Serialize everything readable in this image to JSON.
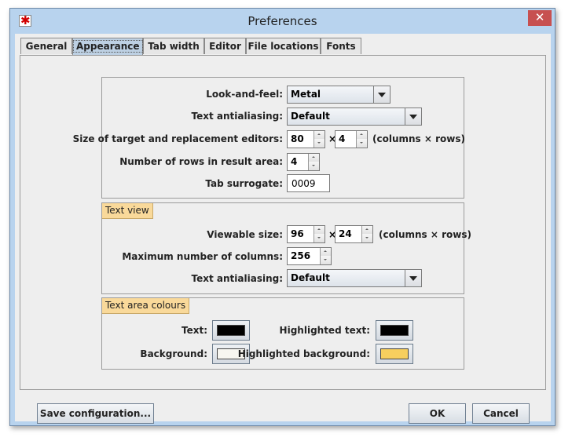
{
  "window": {
    "title": "Preferences",
    "close_glyph": "✕",
    "app_icon_glyph": "✱"
  },
  "tabs": [
    {
      "label": "General",
      "active": false
    },
    {
      "label": "Appearance",
      "active": true
    },
    {
      "label": "Tab width",
      "active": false
    },
    {
      "label": "Editor",
      "active": false
    },
    {
      "label": "File locations",
      "active": false
    },
    {
      "label": "Fonts",
      "active": false
    }
  ],
  "general": {
    "look_and_feel_label": "Look-and-feel:",
    "look_and_feel_value": "Metal",
    "text_antialiasing_label": "Text antialiasing:",
    "text_antialiasing_value": "Default",
    "editor_size_label": "Size of target and replacement editors:",
    "editor_columns": "80",
    "editor_rows": "4",
    "times": "×",
    "columns_rows_unit": "(columns × rows)",
    "result_rows_label": "Number of rows in result area:",
    "result_rows_value": "4",
    "tab_surrogate_label": "Tab surrogate:",
    "tab_surrogate_value": "0009"
  },
  "text_view": {
    "title": "Text view",
    "viewable_size_label": "Viewable size:",
    "viewable_columns": "96",
    "viewable_rows": "24",
    "times": "×",
    "columns_rows_unit": "(columns × rows)",
    "max_columns_label": "Maximum number of columns:",
    "max_columns_value": "256",
    "text_antialiasing_label": "Text antialiasing:",
    "text_antialiasing_value": "Default"
  },
  "text_area_colours": {
    "title": "Text area colours",
    "text_label": "Text:",
    "text_color": "#000000",
    "background_label": "Background:",
    "background_color": "#f7f6f0",
    "highlighted_text_label": "Highlighted text:",
    "highlighted_text_color": "#000000",
    "highlighted_background_label": "Highlighted background:",
    "highlighted_background_color": "#f7cf5e"
  },
  "buttons": {
    "save": "Save configuration...",
    "ok": "OK",
    "cancel": "Cancel"
  }
}
